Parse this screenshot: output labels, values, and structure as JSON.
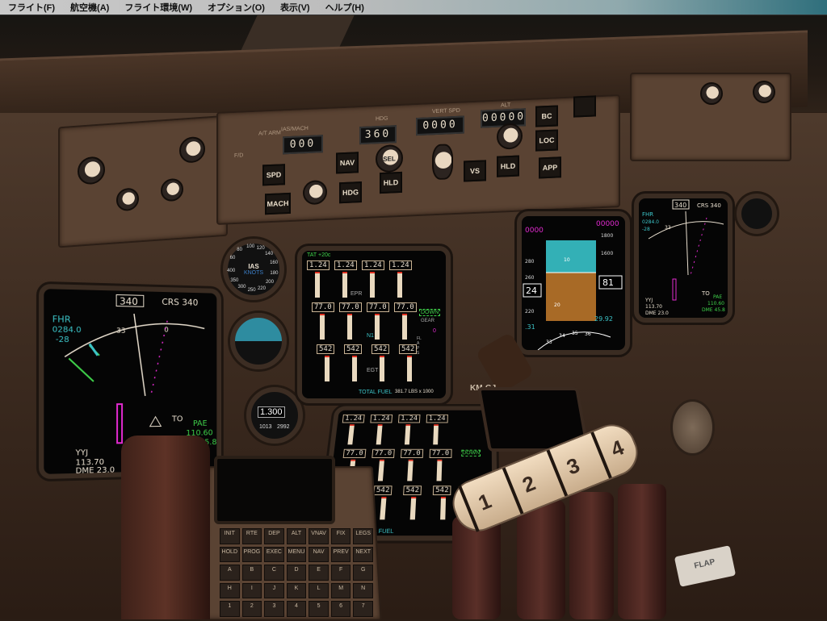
{
  "menu": [
    "フライト(F)",
    "航空機(A)",
    "フライト環境(W)",
    "オプション(O)",
    "表示(V)",
    "ヘルプ(H)"
  ],
  "mcp": {
    "ias_label": "IAS/MACH",
    "hdg_label": "HDG",
    "vs_label": "VERT SPD",
    "alt_label": "ALT",
    "at_label": "A/T ARM",
    "fd_label": "F/D",
    "ias": "000",
    "hdg": "360",
    "vs": "0000",
    "alt": "00000",
    "buttons": {
      "spd": "SPD",
      "mach": "MACH",
      "nav": "NAV",
      "hdg": "HDG",
      "hld": "HLD",
      "sel": "SEL",
      "vs": "VS",
      "alt_hld": "HLD",
      "bc": "BC",
      "loc": "LOC",
      "app": "APP"
    }
  },
  "nd": {
    "left": {
      "heading": "340",
      "crs": "CRS 340",
      "wpt": "FHR",
      "wpt_dist": "0284.0",
      "wpt_alt": "-28",
      "tick_33": "33",
      "tick_0": "0",
      "nav1_id": "YYJ",
      "nav1_freq": "113.70",
      "nav1_dme": "DME 23.0",
      "nav2_id": "PAE",
      "nav2_freq": "110.60",
      "nav2_dme": "DME 45.8",
      "to": "TO"
    },
    "right": {
      "heading": "340",
      "crs": "CRS 340",
      "wpt": "FHR",
      "wpt_dist": "0284.0",
      "wpt_alt": "-28",
      "tick_33": "33",
      "nav1_id": "YYJ",
      "nav1_freq": "113.70",
      "nav1_dme": "DME 23.0",
      "nav2_id": "PAE",
      "nav2_freq": "110.60",
      "nav2_dme": "DME 45.8",
      "to": "TO"
    }
  },
  "pfd": {
    "spd_bug": "0000",
    "alt_bug": "00000",
    "speed": "24",
    "altitude": "81",
    "baro": "29.92",
    "mach": ".31",
    "pitch_10": "10",
    "pitch_20": "20",
    "alt_1800": "1800",
    "alt_1600": "1600",
    "spd_280": "280",
    "spd_260": "260",
    "spd_220": "220",
    "hdg_33": "33",
    "hdg_34": "34",
    "hdg_35": "35",
    "hdg_36": "36"
  },
  "eicas": {
    "tat": "TAT +20c",
    "epr_label": "EPR",
    "n1_label": "N1",
    "egt_label": "EGT",
    "epr": [
      "1.24",
      "1.24",
      "1.24",
      "1.24"
    ],
    "n1": [
      "77.0",
      "77.0",
      "77.0",
      "77.0"
    ],
    "egt": [
      "542",
      "542",
      "542",
      "542"
    ],
    "gear_status": "DOWN",
    "gear_label": "GEAR",
    "flaps_value": "0",
    "flaps_label": "FLAPS",
    "fuel_label": "TOTAL FUEL",
    "fuel_value": "381.7 LBS x 1000"
  },
  "standby": {
    "ias_label": "IAS",
    "ias_unit": "KNOTS",
    "ias_ticks": [
      "60",
      "80",
      "100",
      "120",
      "140",
      "160",
      "180",
      "200",
      "220",
      "250",
      "300",
      "350",
      "400"
    ],
    "alt_value": "1.300",
    "baro_mb": "1013",
    "baro_in": "2992"
  },
  "throttles": [
    "1",
    "2",
    "3",
    "4"
  ],
  "flap_label": "FLAP",
  "registration": "KM-GJ",
  "cdu_keys": [
    "INIT",
    "RTE",
    "DEP",
    "ALT",
    "VNAV",
    "FIX",
    "LEGS",
    "HOLD",
    "PROG",
    "EXEC",
    "MENU",
    "NAV",
    "PREV",
    "NEXT",
    "A",
    "B",
    "C",
    "D",
    "E",
    "F",
    "G",
    "H",
    "I",
    "J",
    "K",
    "L",
    "M",
    "N",
    "1",
    "2",
    "3",
    "4",
    "5",
    "6",
    "7"
  ],
  "colors": {
    "magenta": "#e22ad0",
    "green": "#3fd14a",
    "cyan": "#3cc4c8",
    "white": "#e9dfcf",
    "sky": "#33b0b6",
    "ground": "#a86a26"
  }
}
